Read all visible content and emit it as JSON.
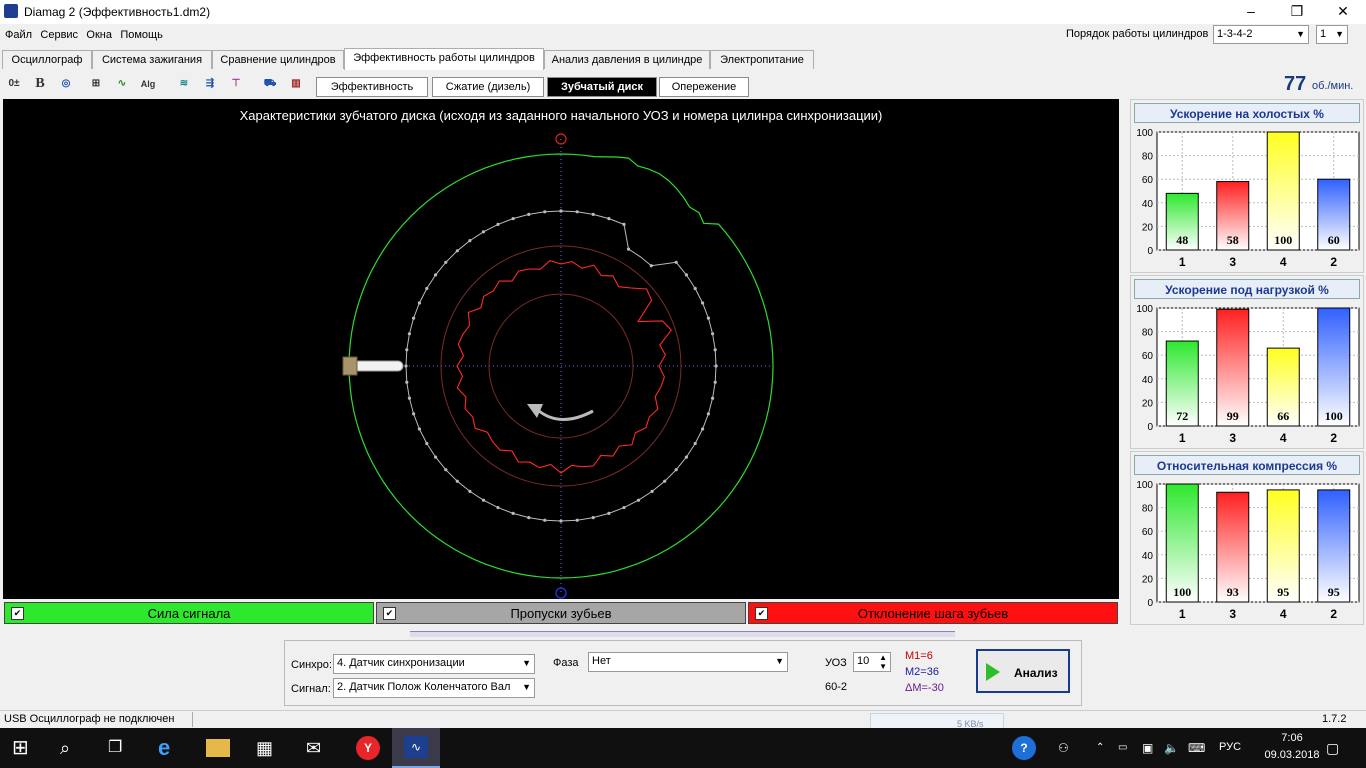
{
  "window": {
    "title": "Diamag 2 (Эффективность1.dm2)",
    "minimize": "–",
    "maximize": "❐",
    "close": "✕"
  },
  "menu": [
    "Файл",
    "Сервис",
    "Окна",
    "Помощь"
  ],
  "cyl_order": {
    "label": "Порядок работы цилиндров",
    "value": "1-3-4-2",
    "spin": "1"
  },
  "tabs": [
    {
      "label": "Осциллограф",
      "active": false
    },
    {
      "label": "Система зажигания",
      "active": false
    },
    {
      "label": "Сравнение цилиндров",
      "active": false
    },
    {
      "label": "Эффективность работы цилиндров",
      "active": true
    },
    {
      "label": "Анализ давления в цилиндре",
      "active": false
    },
    {
      "label": "Электропитание",
      "active": false
    }
  ],
  "toolbar_icons": [
    "zero-adjust-icon",
    "bold-b-icon",
    "rpm-gauge-icon",
    "scale-icon",
    "curve-icon",
    "alg-icon",
    "filter-icon",
    "count-icon",
    "pin-icon",
    "car-icon",
    "bars-icon"
  ],
  "subtabs": [
    {
      "label": "Эффективность",
      "active": false
    },
    {
      "label": "Сжатие (дизель)",
      "active": false
    },
    {
      "label": "Зубчатый диск",
      "active": true
    },
    {
      "label": "Опережение",
      "active": false
    }
  ],
  "rpm": {
    "value": "77",
    "unit": "об./мин."
  },
  "plot": {
    "title": "Характеристики зубчатого диска (исходя из заданного начального УОЗ и номера цилинра синхронизации)",
    "colors": {
      "signal": "#2fdc2f",
      "teeth": "#bbbbbb",
      "deviation": "#ff2a2a",
      "rings": "#7a2b2b",
      "axis": "#6b6bff"
    }
  },
  "legend": [
    {
      "label": "Сила сигнала",
      "checked": true,
      "color": "#2ee82e"
    },
    {
      "label": "Пропуски зубьев",
      "checked": true,
      "color": "#a6a6a6"
    },
    {
      "label": "Отклонение шага зубьев",
      "checked": true,
      "color": "#ff1010"
    }
  ],
  "charts": [
    {
      "title": "Ускорение на холостых %"
    },
    {
      "title": "Ускорение под нагрузкой %"
    },
    {
      "title": "Относительная компрессия %"
    }
  ],
  "chart_data": [
    {
      "type": "bar",
      "title": "Ускорение на холостых %",
      "categories": [
        "1",
        "3",
        "4",
        "2"
      ],
      "values": [
        48,
        58,
        100,
        60
      ],
      "colors": [
        "#2ee82e",
        "#ff2020",
        "#ffff20",
        "#3060ff"
      ],
      "ylim": [
        0,
        100
      ],
      "yticks": [
        "0",
        "20",
        "40",
        "60",
        "80",
        "100"
      ],
      "grid": true
    },
    {
      "type": "bar",
      "title": "Ускорение под нагрузкой %",
      "categories": [
        "1",
        "3",
        "4",
        "2"
      ],
      "values": [
        72,
        99,
        66,
        100
      ],
      "colors": [
        "#2ee82e",
        "#ff2020",
        "#ffff20",
        "#3060ff"
      ],
      "ylim": [
        0,
        100
      ],
      "yticks": [
        "0",
        "20",
        "40",
        "60",
        "80",
        "100"
      ],
      "grid": true
    },
    {
      "type": "bar",
      "title": "Относительная компрессия %",
      "categories": [
        "1",
        "3",
        "4",
        "2"
      ],
      "values": [
        100,
        93,
        95,
        95
      ],
      "colors": [
        "#2ee82e",
        "#ff2020",
        "#ffff20",
        "#3060ff"
      ],
      "ylim": [
        0,
        100
      ],
      "yticks": [
        "0",
        "20",
        "40",
        "60",
        "80",
        "100"
      ],
      "grid": true
    }
  ],
  "controls": {
    "sync_label": "Синхро:",
    "sync_value": "4.  Датчик синхронизации",
    "signal_label": "Сигнал:",
    "signal_value": "2.  Датчик Полож Коленчатого Вал",
    "phase_label": "Фаза",
    "phase_value": "Нет",
    "uoz_label": "УОЗ",
    "uoz_value": "10",
    "teeth": "60-2",
    "m1": "M1=6",
    "m2": "M2=36",
    "dm": "ΔM=-30",
    "analyze": "Анализ"
  },
  "status": {
    "text": "USB Осциллограф не подключен",
    "version": "1.7.2",
    "speed": "5 KB/s"
  },
  "taskbar": {
    "lang": "РУС",
    "time": "7:06",
    "date": "09.03.2018"
  }
}
